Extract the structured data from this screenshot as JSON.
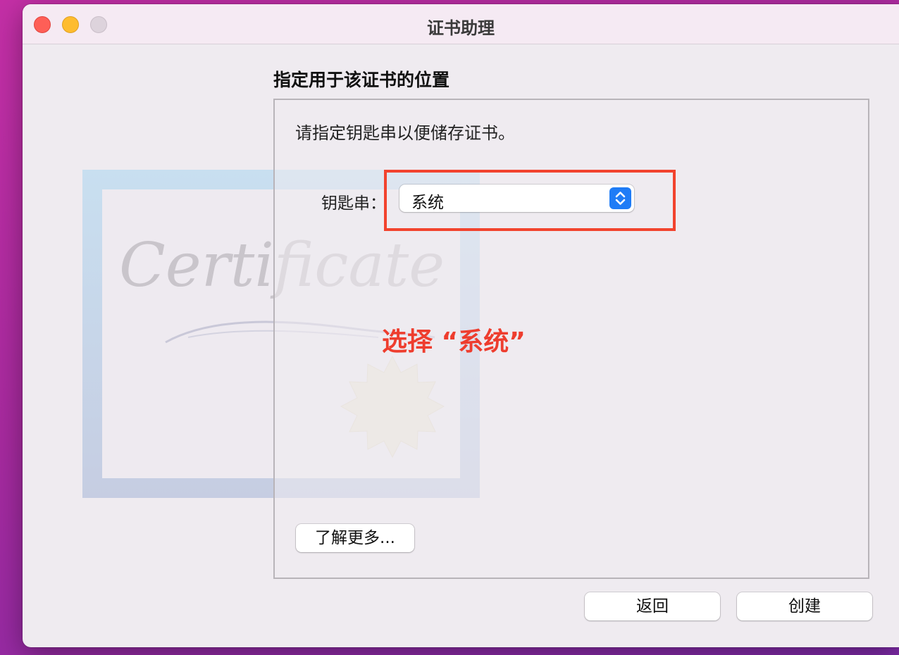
{
  "window": {
    "title": "证书助理"
  },
  "background_art": {
    "certificate_text": "Certificate"
  },
  "main": {
    "heading": "指定用于该证书的位置",
    "instruction": "请指定钥匙串以便储存证书。",
    "keychain_label": "钥匙串：",
    "keychain_value": "系统",
    "learn_more_label": "了解更多..."
  },
  "annotation": {
    "text": "选择 “系统”",
    "color": "#ee3d2e"
  },
  "footer": {
    "back_label": "返回",
    "create_label": "创建"
  },
  "colors": {
    "accent": "#1f7cf6",
    "highlight_border": "#f2432e"
  }
}
